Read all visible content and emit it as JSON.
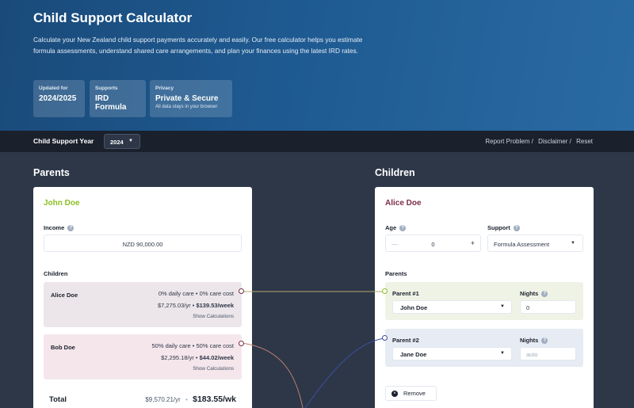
{
  "hero": {
    "title": "Child Support Calculator",
    "description": "Calculate your New Zealand child support payments accurately and easily. Our free calculator helps you estimate formula assessments, understand shared care arrangements, and plan your finances using the latest IRD rates.",
    "badges": [
      {
        "label": "Updated for",
        "value": "2024/2025",
        "sub": ""
      },
      {
        "label": "Supports",
        "value": "IRD Formula",
        "sub": ""
      },
      {
        "label": "Privacy",
        "value": "Private & Secure",
        "sub": "All data stays in your browser"
      }
    ]
  },
  "toolbar": {
    "year_label": "Child Support Year",
    "year_value": "2024",
    "links": [
      "Report Problem /",
      "Disclaimer /",
      "Reset"
    ]
  },
  "parents": {
    "heading": "Parents",
    "card": {
      "name": "John Doe",
      "income_label": "Income",
      "income_value": "NZD 90,000.00",
      "children_label": "Children",
      "children": [
        {
          "name": "Alice Doe",
          "care": "0% daily care • 0% care cost",
          "yearly": "$7,275.03/yr • ",
          "weekly": "$139.53/week",
          "action": "Show Calculations"
        },
        {
          "name": "Bob Doe",
          "care": "50% daily care • 50% care cost",
          "yearly": "$2,295.18/yr • ",
          "weekly": "$44.02/week",
          "action": "Show Calculations"
        }
      ],
      "total_label": "Total",
      "total_yearly": "$9,570.21/yr",
      "total_sep": "•",
      "total_weekly": "$183.55/wk"
    }
  },
  "children_section": {
    "heading": "Children",
    "card": {
      "name": "Alice Doe",
      "age_label": "Age",
      "age_value": "0",
      "age_minus": "—",
      "age_plus": "+",
      "support_label": "Support",
      "support_value": "Formula Assessment",
      "parents_label": "Parents",
      "parent_rows": [
        {
          "label": "Parent #1",
          "value": "John Doe",
          "nights_label": "Nights",
          "nights_value": "0",
          "nights_placeholder": ""
        },
        {
          "label": "Parent #2",
          "value": "Jane Doe",
          "nights_label": "Nights",
          "nights_value": "",
          "nights_placeholder": "auto"
        }
      ],
      "remove_label": "Remove"
    }
  },
  "colors": {
    "parent_green": "#8bbf25",
    "child_maroon": "#7c2d4a",
    "connector_alice": "#b5a56a",
    "connector_bob": "#c08070",
    "connector_parent2": "#3d4f9f"
  }
}
